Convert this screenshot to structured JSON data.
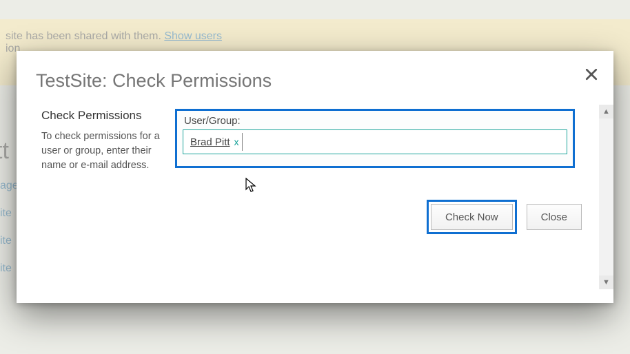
{
  "page_background": {
    "notice_text_part1": "site has been shared with them.",
    "notice_link": "Show users",
    "notice_text_part2": "ion",
    "side_links": [
      "",
      "age",
      "ite",
      "ite",
      "ite"
    ],
    "cutoff_heading": "tt"
  },
  "dialog": {
    "title": "TestSite: Check Permissions",
    "section_heading": "Check Permissions",
    "section_help": "To check permissions for a user or group, enter their name or e-mail address.",
    "field_label": "User/Group:",
    "selected_user": "Brad Pitt",
    "remove_chip_glyph": "x",
    "buttons": {
      "check_now": "Check Now",
      "close": "Close"
    }
  }
}
